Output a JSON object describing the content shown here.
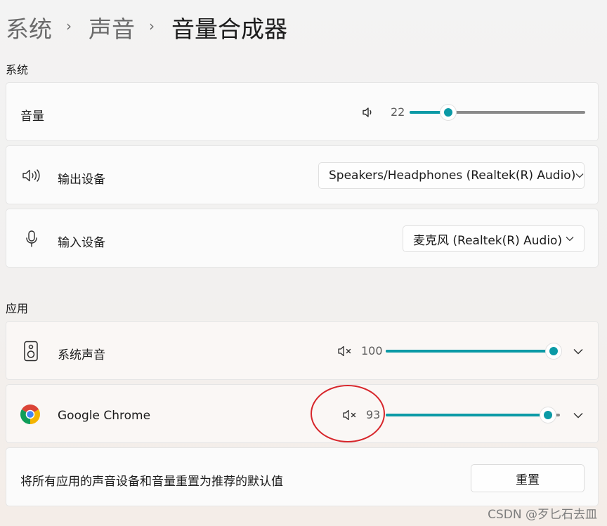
{
  "breadcrumb": {
    "level1": "系统",
    "level2": "声音",
    "current": "音量合成器",
    "separator": "›"
  },
  "sections": {
    "system": "系统",
    "apps": "应用"
  },
  "system": {
    "volume": {
      "label": "音量",
      "value": "22",
      "level": 0.22
    },
    "output": {
      "label": "输出设备",
      "selected": "Speakers/Headphones (Realtek(R) Audio)"
    },
    "input": {
      "label": "输入设备",
      "selected": "麦克风 (Realtek(R) Audio)"
    }
  },
  "apps": {
    "items": [
      {
        "name": "系统声音",
        "value": "100",
        "level": 1.0,
        "icon": "speaker-device-icon"
      },
      {
        "name": "Google Chrome",
        "value": "93",
        "level": 0.93,
        "icon": "chrome-logo-icon"
      }
    ]
  },
  "reset": {
    "label": "将所有应用的声音设备和音量重置为推荐的默认值",
    "button": "重置"
  },
  "watermark": "CSDN @歹匕石去皿",
  "colors": {
    "accent": "#0b9aa6",
    "annotation": "#d7262b"
  }
}
